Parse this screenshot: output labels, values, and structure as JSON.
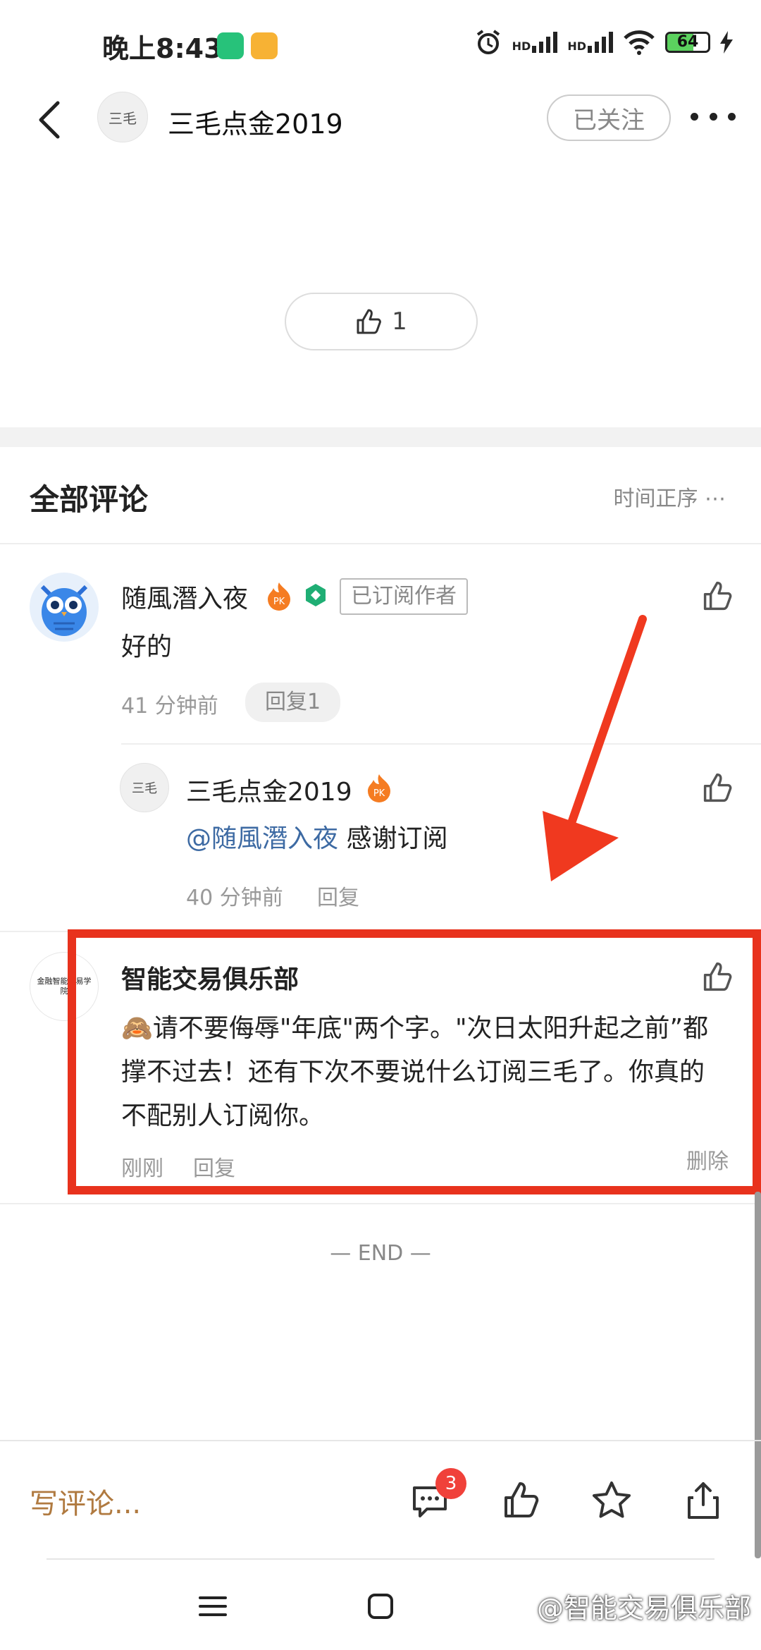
{
  "status": {
    "time": "晚上8:43",
    "network_hd1": "HD",
    "network_hd2": "HD",
    "battery": "64",
    "battery_level": 0.64
  },
  "header": {
    "title": "三毛点金2019",
    "avatar_text": "三毛",
    "follow_label": "已关注"
  },
  "post": {
    "like_count": "1"
  },
  "comments_section": {
    "title": "全部评论",
    "sort_label": "时间正序",
    "sort_more": "⋯"
  },
  "comments": [
    {
      "name": "随風潛入夜",
      "badge_pk": "PK",
      "tag": "已订阅作者",
      "text": "好的",
      "time": "41 分钟前",
      "reply_label": "回复1"
    },
    {
      "name": "三毛点金2019",
      "avatar_text": "三毛",
      "badge_pk": "PK",
      "mention": "@随風潛入夜",
      "text": "感谢订阅",
      "time": "40 分钟前",
      "reply_label": "回复"
    },
    {
      "name": "智能交易俱乐部",
      "avatar_text": "金融智能交易学院",
      "text": "🙈请不要侮辱\"年底\"两个字。\"次日太阳升起之前”都撑不过去！还有下次不要说什么订阅三毛了。你真的不配别人订阅你。",
      "time": "刚刚",
      "reply_label": "回复",
      "delete_label": "删除"
    }
  ],
  "end_label": "— END —",
  "bottom": {
    "write_placeholder": "写评论...",
    "comment_count": "3"
  },
  "watermark": "@智能交易俱乐部",
  "colors": {
    "highlight_box": "#e8321d",
    "arrow": "#f0391f",
    "mention": "#3d6aa3",
    "write_text": "#b07a40",
    "badge": "#f0413a"
  }
}
